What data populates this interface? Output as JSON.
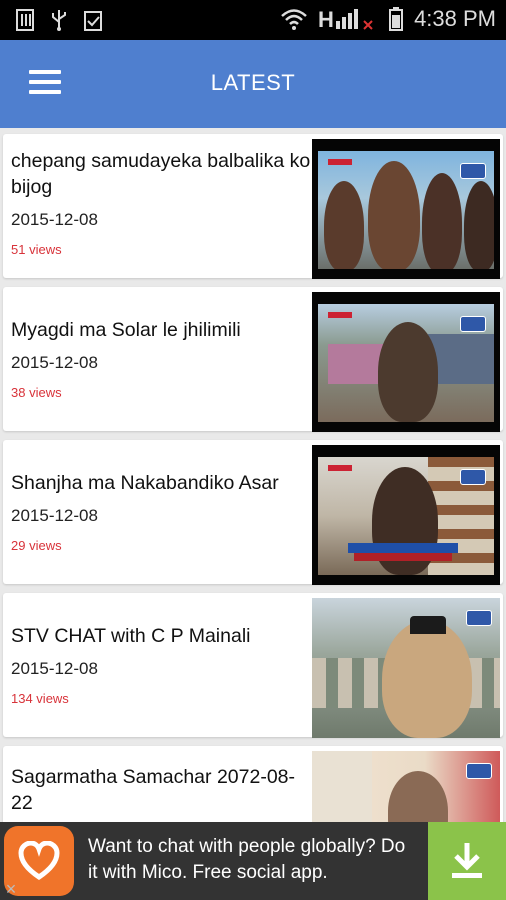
{
  "status_bar": {
    "time": "4:38 PM",
    "icons": [
      "sim-icon",
      "usb-icon",
      "clipboard-icon",
      "wifi-icon",
      "signal-icon",
      "battery-icon"
    ]
  },
  "app_bar": {
    "title": "LATEST",
    "menu_icon": "hamburger-icon"
  },
  "videos": [
    {
      "title": "chepang samudayeka balbalika ko bijog",
      "date": "2015-12-08",
      "views": "51  views"
    },
    {
      "title": "Myagdi ma Solar le jhilimili",
      "date": "2015-12-08",
      "views": "38  views"
    },
    {
      "title": "Shanjha ma Nakabandiko Asar",
      "date": "2015-12-08",
      "views": "29  views"
    },
    {
      "title": "STV CHAT with C P Mainali",
      "date": "2015-12-08",
      "views": "134  views"
    },
    {
      "title": "Sagarmatha Samachar 2072-08-22",
      "date": "",
      "views": ""
    }
  ],
  "ad": {
    "text": "Want to chat with people globally? Do it with Mico. Free social app.",
    "close_label": "×",
    "brand_color": "#f0742a",
    "download_color": "#8bc34a"
  },
  "colors": {
    "app_bar": "#4f7fcf",
    "views_text": "#d8333a"
  }
}
